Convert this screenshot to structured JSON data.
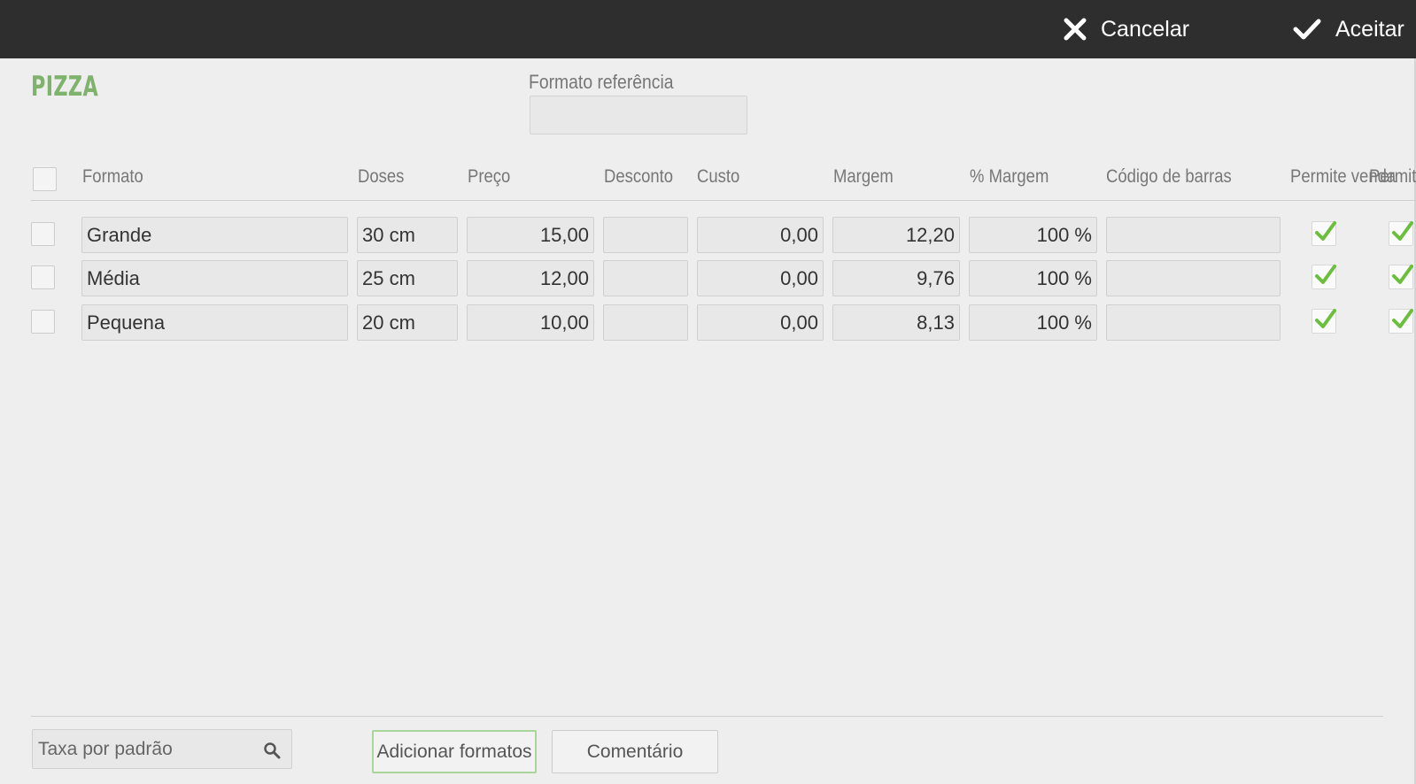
{
  "topbar": {
    "cancel_label": "Cancelar",
    "accept_label": "Aceitar",
    "cancel_icon": "close-icon",
    "accept_icon": "check-icon"
  },
  "product_title": "PIZZA",
  "reference_format": {
    "label": "Formato referência",
    "value": ""
  },
  "table": {
    "headers": [
      "Formato",
      "Doses",
      "Preço",
      "Desconto",
      "Custo",
      "Margem",
      "% Margem",
      "Código de barras",
      "Permite venda",
      "Permit"
    ],
    "rows": [
      {
        "formato": "Grande",
        "doses": "30 cm",
        "preco": "15,00",
        "desconto": "",
        "custo": "0,00",
        "margem": "12,20",
        "pct_margem": "100 %",
        "codigo": "",
        "permite_venda": true,
        "permite_2": true
      },
      {
        "formato": "Média",
        "doses": "25 cm",
        "preco": "12,00",
        "desconto": "",
        "custo": "0,00",
        "margem": "9,76",
        "pct_margem": "100 %",
        "codigo": "",
        "permite_venda": true,
        "permite_2": true
      },
      {
        "formato": "Pequena",
        "doses": "20 cm",
        "preco": "10,00",
        "desconto": "",
        "custo": "0,00",
        "margem": "8,13",
        "pct_margem": "100 %",
        "codigo": "",
        "permite_venda": true,
        "permite_2": true
      }
    ]
  },
  "footer": {
    "tax_placeholder": "Taxa por padrão",
    "add_formats_label": "Adicionar formatos",
    "comment_label": "Comentário"
  },
  "colors": {
    "topbar": "#2e2e2e",
    "accent_green": "#7fb36d",
    "check_green": "#6cbf3c",
    "background": "#eeeeee"
  }
}
